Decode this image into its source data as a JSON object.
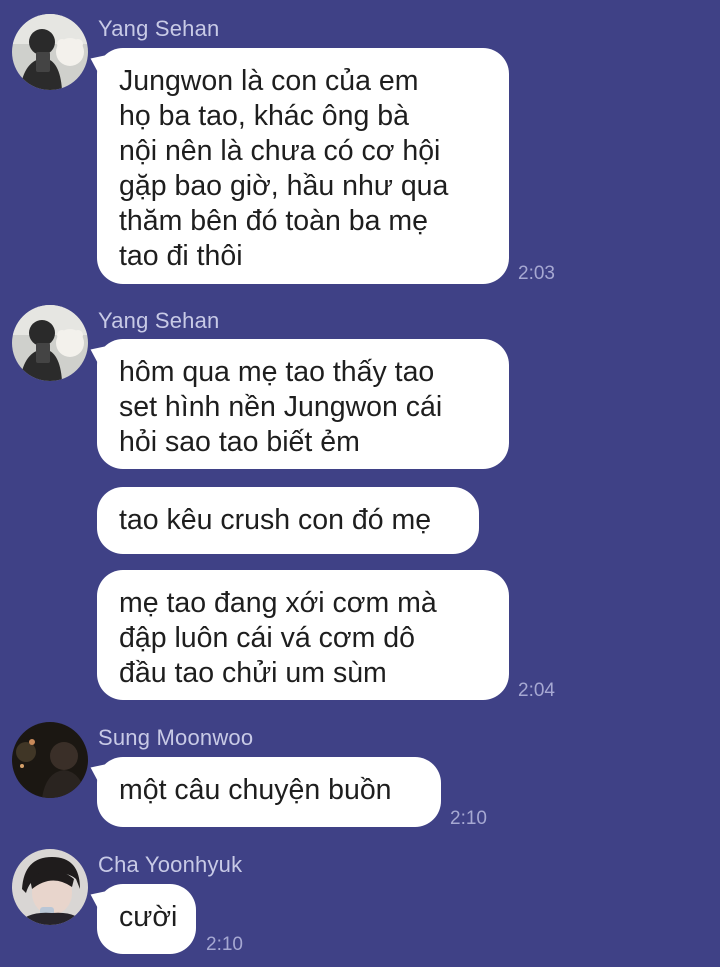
{
  "messages": [
    {
      "sender": "Yang Sehan",
      "avatar_icon": "person-with-plush-avatar-icon",
      "bubbles": [
        "Jungwon là con của em\nhọ ba tao, khác ông bà\nnội nên là chưa có cơ hội\ngặp bao giờ, hầu như qua\nthăm bên đó toàn ba mẹ\ntao đi thôi"
      ],
      "time": "2:03"
    },
    {
      "sender": "Yang Sehan",
      "avatar_icon": "person-with-plush-avatar-icon",
      "bubbles": [
        "hôm qua mẹ tao thấy tao\nset hình nền Jungwon cái\nhỏi sao tao biết ẻm",
        "tao kêu crush con đó mẹ",
        "mẹ tao đang xới cơm mà\nđập luôn cái vá cơm dô\nđầu tao chửi um sùm"
      ],
      "time": "2:04"
    },
    {
      "sender": "Sung Moonwoo",
      "avatar_icon": "dark-portrait-avatar-icon",
      "bubbles": [
        "một câu chuyện buồn"
      ],
      "time": "2:10"
    },
    {
      "sender": "Cha Yoonhyuk",
      "avatar_icon": "portrait-avatar-icon",
      "bubbles": [
        "cười"
      ],
      "time": "2:10"
    }
  ],
  "colors": {
    "background": "#3f4186",
    "bubble": "#ffffff",
    "sender_name": "#c8cae6",
    "timestamp": "#a6a8d2"
  }
}
